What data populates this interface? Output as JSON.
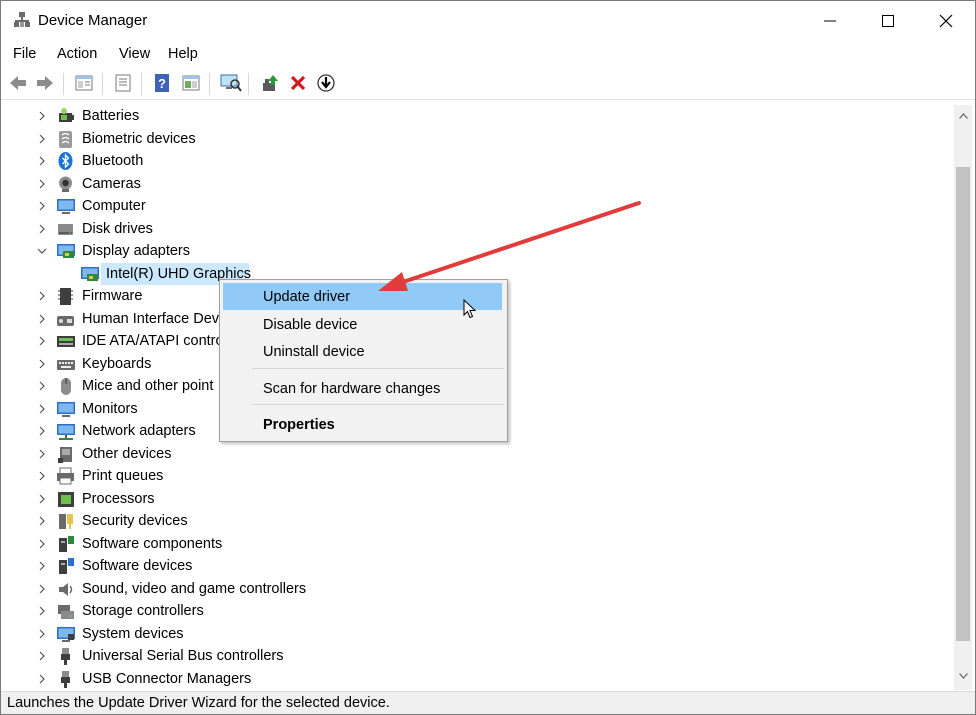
{
  "window": {
    "title": "Device Manager"
  },
  "menu": [
    "File",
    "Action",
    "View",
    "Help"
  ],
  "toolbar": [
    "back-icon",
    "forward-icon",
    "properties-icon",
    "show-hidden-icon",
    "help-icon",
    "view-icon",
    "scan-hardware-icon",
    "update-driver-icon",
    "uninstall-icon",
    "disable-icon"
  ],
  "tree": {
    "items": [
      {
        "label": "Batteries",
        "icon": "battery-icon"
      },
      {
        "label": "Biometric devices",
        "icon": "fingerprint-icon"
      },
      {
        "label": "Bluetooth",
        "icon": "bluetooth-icon"
      },
      {
        "label": "Cameras",
        "icon": "camera-icon"
      },
      {
        "label": "Computer",
        "icon": "computer-icon"
      },
      {
        "label": "Disk drives",
        "icon": "disk-icon"
      },
      {
        "label": "Display adapters",
        "icon": "display-adapter-icon",
        "expanded": true
      },
      {
        "label": "Intel(R) UHD Graphics",
        "icon": "display-adapter-icon",
        "child": true,
        "selected": true
      },
      {
        "label": "Firmware",
        "icon": "firmware-icon"
      },
      {
        "label": "Human Interface Devi",
        "icon": "hid-icon"
      },
      {
        "label": "IDE ATA/ATAPI controll",
        "icon": "ide-icon"
      },
      {
        "label": "Keyboards",
        "icon": "keyboard-icon"
      },
      {
        "label": "Mice and other point",
        "icon": "mouse-icon"
      },
      {
        "label": "Monitors",
        "icon": "monitor-icon"
      },
      {
        "label": "Network adapters",
        "icon": "network-icon"
      },
      {
        "label": "Other devices",
        "icon": "other-device-icon"
      },
      {
        "label": "Print queues",
        "icon": "printer-icon"
      },
      {
        "label": "Processors",
        "icon": "processor-icon"
      },
      {
        "label": "Security devices",
        "icon": "security-icon"
      },
      {
        "label": "Software components",
        "icon": "software-component-icon"
      },
      {
        "label": "Software devices",
        "icon": "software-device-icon"
      },
      {
        "label": "Sound, video and game controllers",
        "icon": "sound-icon"
      },
      {
        "label": "Storage controllers",
        "icon": "storage-icon"
      },
      {
        "label": "System devices",
        "icon": "system-icon"
      },
      {
        "label": "Universal Serial Bus controllers",
        "icon": "usb-icon"
      },
      {
        "label": "USB Connector Managers",
        "icon": "usb-icon"
      }
    ]
  },
  "context_menu": {
    "update": "Update driver",
    "disable": "Disable device",
    "uninstall": "Uninstall device",
    "scan": "Scan for hardware changes",
    "properties": "Properties"
  },
  "status": {
    "text": "Launches the Update Driver Wizard for the selected device."
  },
  "colors": {
    "selection": "#cce8ff",
    "menu_highlight": "#91c9f7",
    "annotation_arrow": "#e03c3c"
  }
}
